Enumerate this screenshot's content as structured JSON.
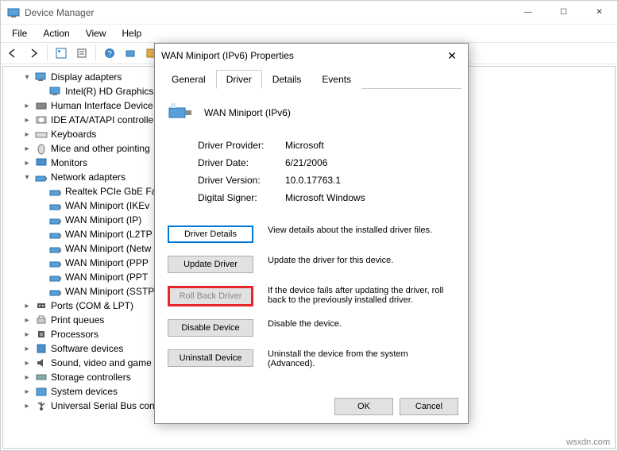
{
  "window": {
    "title": "Device Manager",
    "menu": [
      "File",
      "Action",
      "View",
      "Help"
    ]
  },
  "tree": {
    "items": [
      {
        "indent": 1,
        "exp": "▾",
        "icon": "display",
        "label": "Display adapters"
      },
      {
        "indent": 2,
        "exp": "",
        "icon": "display",
        "label": "Intel(R) HD Graphics"
      },
      {
        "indent": 1,
        "exp": "▸",
        "icon": "hid",
        "label": "Human Interface Device"
      },
      {
        "indent": 1,
        "exp": "▸",
        "icon": "ide",
        "label": "IDE ATA/ATAPI controlle"
      },
      {
        "indent": 1,
        "exp": "▸",
        "icon": "keyboard",
        "label": "Keyboards"
      },
      {
        "indent": 1,
        "exp": "▸",
        "icon": "mouse",
        "label": "Mice and other pointing"
      },
      {
        "indent": 1,
        "exp": "▸",
        "icon": "monitor",
        "label": "Monitors"
      },
      {
        "indent": 1,
        "exp": "▾",
        "icon": "net",
        "label": "Network adapters"
      },
      {
        "indent": 2,
        "exp": "",
        "icon": "net",
        "label": "Realtek PCIe GbE Fam"
      },
      {
        "indent": 2,
        "exp": "",
        "icon": "net",
        "label": "WAN Miniport (IKEv"
      },
      {
        "indent": 2,
        "exp": "",
        "icon": "net",
        "label": "WAN Miniport (IP)"
      },
      {
        "indent": 2,
        "exp": "",
        "icon": "net",
        "label": "WAN Miniport (L2TP"
      },
      {
        "indent": 2,
        "exp": "",
        "icon": "net",
        "label": "WAN Miniport (Netw"
      },
      {
        "indent": 2,
        "exp": "",
        "icon": "net",
        "label": "WAN Miniport (PPP"
      },
      {
        "indent": 2,
        "exp": "",
        "icon": "net",
        "label": "WAN Miniport (PPT"
      },
      {
        "indent": 2,
        "exp": "",
        "icon": "net",
        "label": "WAN Miniport (SSTP"
      },
      {
        "indent": 1,
        "exp": "▸",
        "icon": "port",
        "label": "Ports (COM & LPT)"
      },
      {
        "indent": 1,
        "exp": "▸",
        "icon": "queue",
        "label": "Print queues"
      },
      {
        "indent": 1,
        "exp": "▸",
        "icon": "cpu",
        "label": "Processors"
      },
      {
        "indent": 1,
        "exp": "▸",
        "icon": "sw",
        "label": "Software devices"
      },
      {
        "indent": 1,
        "exp": "▸",
        "icon": "sound",
        "label": "Sound, video and game"
      },
      {
        "indent": 1,
        "exp": "▸",
        "icon": "storage",
        "label": "Storage controllers"
      },
      {
        "indent": 1,
        "exp": "▸",
        "icon": "sys",
        "label": "System devices"
      },
      {
        "indent": 1,
        "exp": "▸",
        "icon": "usb",
        "label": "Universal Serial Bus contr"
      }
    ]
  },
  "dialog": {
    "title": "WAN Miniport (IPv6) Properties",
    "tabs": [
      "General",
      "Driver",
      "Details",
      "Events"
    ],
    "active_tab": 1,
    "device_name": "WAN Miniport (IPv6)",
    "info": {
      "provider_k": "Driver Provider:",
      "provider_v": "Microsoft",
      "date_k": "Driver Date:",
      "date_v": "6/21/2006",
      "version_k": "Driver Version:",
      "version_v": "10.0.17763.1",
      "signer_k": "Digital Signer:",
      "signer_v": "Microsoft Windows"
    },
    "buttons": {
      "details": "Driver Details",
      "details_desc": "View details about the installed driver files.",
      "update": "Update Driver",
      "update_desc": "Update the driver for this device.",
      "rollback": "Roll Back Driver",
      "rollback_desc": "If the device fails after updating the driver, roll back to the previously installed driver.",
      "disable": "Disable Device",
      "disable_desc": "Disable the device.",
      "uninstall": "Uninstall Device",
      "uninstall_desc": "Uninstall the device from the system (Advanced).",
      "ok": "OK",
      "cancel": "Cancel"
    }
  },
  "watermark": "wsxdn.com"
}
